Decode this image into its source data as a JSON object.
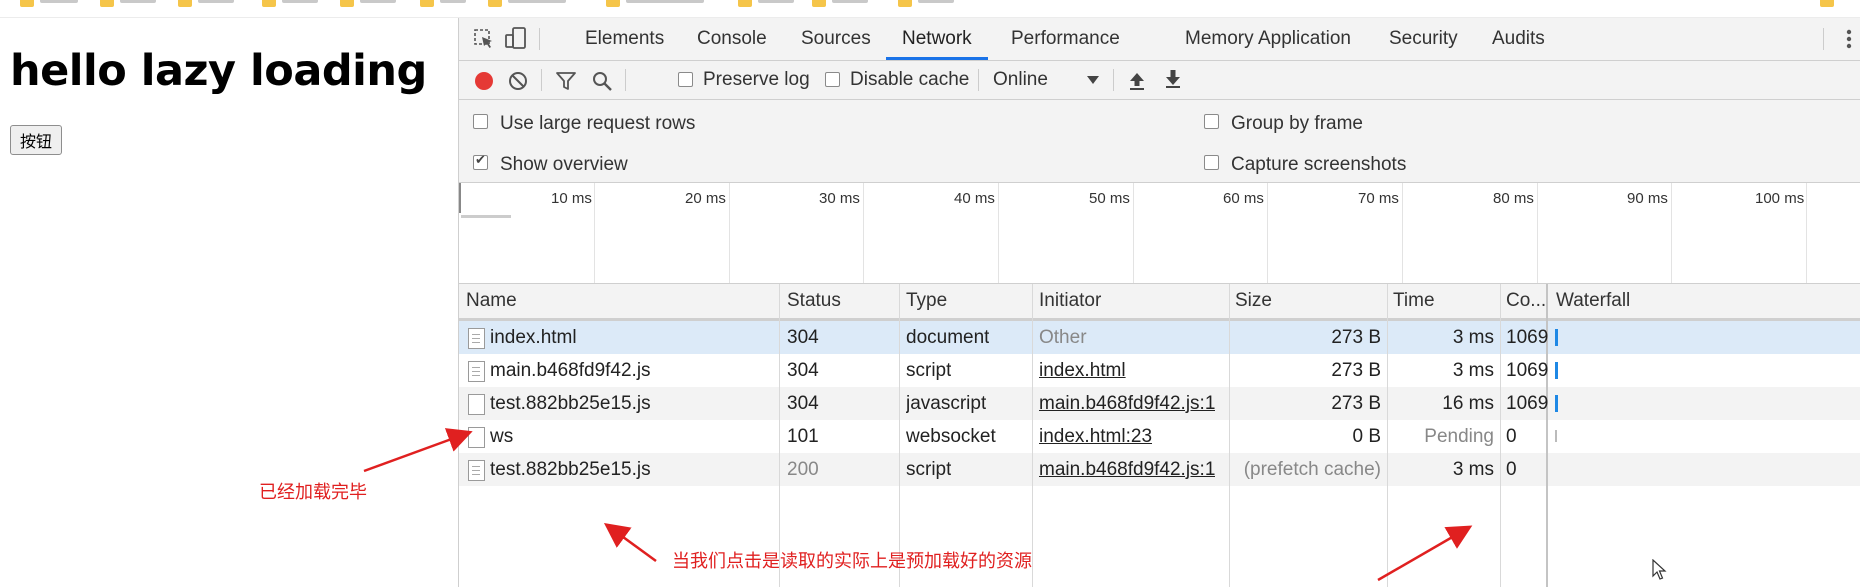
{
  "page": {
    "heading": "hello lazy loading",
    "button_label": "按钮"
  },
  "devtools": {
    "tabs": [
      "Elements",
      "Console",
      "Sources",
      "Network",
      "Performance",
      "Memory",
      "Application",
      "Security",
      "Audits"
    ],
    "active_tab": "Network",
    "toolbar": {
      "preserve_log": "Preserve log",
      "disable_cache": "Disable cache",
      "throttle": "Online"
    },
    "settings": {
      "large_rows": "Use large request rows",
      "group_by_frame": "Group by frame",
      "show_overview": "Show overview",
      "capture_screenshots": "Capture screenshots"
    },
    "overview_ticks": [
      "10 ms",
      "20 ms",
      "30 ms",
      "40 ms",
      "50 ms",
      "60 ms",
      "70 ms",
      "80 ms",
      "90 ms",
      "100 ms"
    ],
    "columns": {
      "name": "Name",
      "status": "Status",
      "type": "Type",
      "initiator": "Initiator",
      "size": "Size",
      "time": "Time",
      "connection": "Co...",
      "waterfall": "Waterfall"
    },
    "rows": [
      {
        "name": "index.html",
        "status": "304",
        "type": "document",
        "initiator": "Other",
        "size": "273 B",
        "time": "3 ms",
        "conn": "1069"
      },
      {
        "name": "main.b468fd9f42.js",
        "status": "304",
        "type": "script",
        "initiator": "index.html",
        "size": "273 B",
        "time": "3 ms",
        "conn": "1069"
      },
      {
        "name": "test.882bb25e15.js",
        "status": "304",
        "type": "javascript",
        "initiator": "main.b468fd9f42.js:1",
        "size": "273 B",
        "time": "16 ms",
        "conn": "1069"
      },
      {
        "name": "ws",
        "status": "101",
        "type": "websocket",
        "initiator": "index.html:23",
        "size": "0 B",
        "time": "Pending",
        "conn": "0"
      },
      {
        "name": "test.882bb25e15.js",
        "status": "200",
        "type": "script",
        "initiator": "main.b468fd9f42.js:1",
        "size": "(prefetch cache)",
        "time": "3 ms",
        "conn": "0"
      }
    ]
  },
  "annotations": {
    "loaded": "已经加载完毕",
    "explain": "当我们点击是读取的实际上是预加载好的资源"
  },
  "colors": {
    "accent": "#1a73e8",
    "record": "#e53935",
    "annotation": "#e02020",
    "selected_row": "#dceaf8"
  }
}
